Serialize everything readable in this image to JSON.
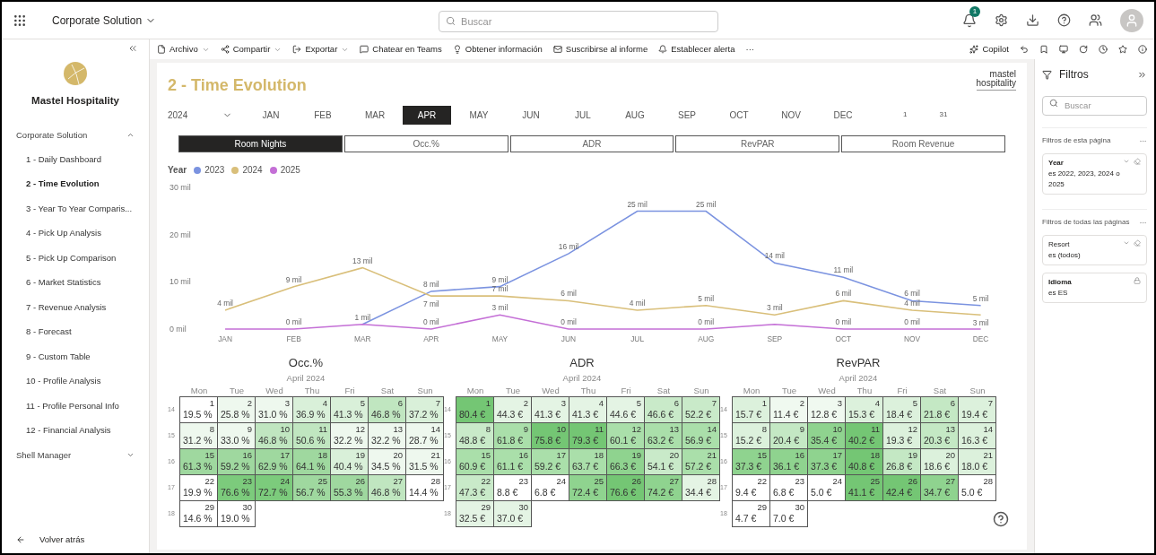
{
  "topbar": {
    "workspace": "Corporate Solution",
    "search": {
      "placeholder": "Buscar"
    },
    "notification_count": "1"
  },
  "toolbar": {
    "items": [
      {
        "label": "Archivo",
        "dropdown": true
      },
      {
        "label": "Compartir",
        "dropdown": true
      },
      {
        "label": "Exportar",
        "dropdown": true
      },
      {
        "label": "Chatear en Teams",
        "dropdown": false
      },
      {
        "label": "Obtener información",
        "dropdown": false
      },
      {
        "label": "Suscribirse al informe",
        "dropdown": false
      },
      {
        "label": "Establecer alerta",
        "dropdown": false
      }
    ],
    "more": "···",
    "copilot": "Copilot"
  },
  "sidebar": {
    "brand": "Mastel Hospitality",
    "sections": [
      {
        "label": "Corporate Solution",
        "expanded": true,
        "children": [
          {
            "label": "1 - Daily Dashboard",
            "selected": false
          },
          {
            "label": "2 - Time Evolution",
            "selected": true
          },
          {
            "label": "3 - Year To Year Comparis...",
            "selected": false
          },
          {
            "label": "4 - Pick Up Analysis",
            "selected": false
          },
          {
            "label": "5 - Pick Up Comparison",
            "selected": false
          },
          {
            "label": "6 - Market Statistics",
            "selected": false
          },
          {
            "label": "7 - Revenue Analysis",
            "selected": false
          },
          {
            "label": "8 - Forecast",
            "selected": false
          },
          {
            "label": "9 - Custom Table",
            "selected": false
          },
          {
            "label": "10 - Profile Analysis",
            "selected": false
          },
          {
            "label": "11 - Profile Personal Info",
            "selected": false
          },
          {
            "label": "12 - Financial Analysis",
            "selected": false
          }
        ]
      },
      {
        "label": "Shell Manager",
        "expanded": false
      }
    ],
    "back": "Volver atrás"
  },
  "report": {
    "title": "2 - Time Evolution",
    "logo_lines": [
      "mastel",
      "hospitality"
    ],
    "year": "2024",
    "months": [
      {
        "label": "JAN",
        "selected": false
      },
      {
        "label": "FEB",
        "selected": false
      },
      {
        "label": "MAR",
        "selected": false
      },
      {
        "label": "APR",
        "selected": true
      },
      {
        "label": "MAY",
        "selected": false
      },
      {
        "label": "JUN",
        "selected": false
      },
      {
        "label": "JUL",
        "selected": false
      },
      {
        "label": "AUG",
        "selected": false
      },
      {
        "label": "SEP",
        "selected": false
      },
      {
        "label": "OCT",
        "selected": false
      },
      {
        "label": "NOV",
        "selected": false
      },
      {
        "label": "DEC",
        "selected": false
      }
    ],
    "day_range": [
      "1",
      "31"
    ],
    "metrics": [
      {
        "label": "Room Nights",
        "selected": true
      },
      {
        "label": "Occ.%",
        "selected": false
      },
      {
        "label": "ADR",
        "selected": false
      },
      {
        "label": "RevPAR",
        "selected": false
      },
      {
        "label": "Room Revenue",
        "selected": false
      }
    ],
    "legend_title": "Year",
    "chart_data": {
      "type": "line",
      "categories": [
        "JAN",
        "FEB",
        "MAR",
        "APR",
        "MAY",
        "JUN",
        "JUL",
        "AUG",
        "SEP",
        "OCT",
        "NOV",
        "DEC"
      ],
      "ylim": [
        0,
        30
      ],
      "yticks": [
        {
          "value": 0,
          "label": "0 mil"
        },
        {
          "value": 10,
          "label": "10 mil"
        },
        {
          "value": 20,
          "label": "20 mil"
        },
        {
          "value": 30,
          "label": "30 mil"
        }
      ],
      "series": [
        {
          "name": "2023",
          "color": "#7b93e0",
          "values": [
            null,
            null,
            1,
            8,
            9,
            16,
            25,
            25,
            14,
            11,
            6,
            5
          ],
          "value_labels": [
            null,
            null,
            "1 mil",
            "8 mil",
            "9 mil",
            "16 mil",
            "25 mil",
            "25 mil",
            "14 mil",
            "11 mil",
            "6 mil",
            "5 mil"
          ]
        },
        {
          "name": "2024",
          "color": "#d9bf7a",
          "values": [
            4,
            9,
            13,
            7,
            7,
            6,
            4,
            5,
            3,
            6,
            4,
            3
          ],
          "value_labels": [
            "4 mil",
            "9 mil",
            "13 mil",
            "7 mil",
            "7 mil",
            "6 mil",
            "4 mil",
            "5 mil",
            "3 mil",
            "6 mil",
            "4 mil",
            "3 mil"
          ]
        },
        {
          "name": "2025",
          "color": "#c46fd6",
          "values": [
            0,
            0,
            1,
            0,
            3,
            0,
            0,
            0,
            1,
            0,
            0,
            0
          ],
          "value_labels": [
            null,
            "0 mil",
            null,
            "0 mil",
            "3 mil",
            "0 mil",
            null,
            "0 mil",
            null,
            "0 mil",
            "0 mil",
            null
          ]
        }
      ]
    },
    "calendars": [
      {
        "title": "Occ.%",
        "month": "April 2024",
        "weekdays": [
          "Mon",
          "Tue",
          "Wed",
          "Thu",
          "Fri",
          "Sat",
          "Sun"
        ],
        "weeks": [
          "14",
          "15",
          "16",
          "17",
          "18"
        ],
        "cells": [
          {
            "day": "1",
            "value": "19.5 %",
            "color": "#ffffff"
          },
          {
            "day": "2",
            "value": "25.8 %",
            "color": "#eef8ee"
          },
          {
            "day": "3",
            "value": "31.0 %",
            "color": "#eef8ee"
          },
          {
            "day": "4",
            "value": "36.9 %",
            "color": "#d9f0d9"
          },
          {
            "day": "5",
            "value": "41.3 %",
            "color": "#d9f0d9"
          },
          {
            "day": "6",
            "value": "46.8 %",
            "color": "#c0e6c0"
          },
          {
            "day": "7",
            "value": "37.2 %",
            "color": "#d9f0d9"
          },
          {
            "day": "8",
            "value": "31.2 %",
            "color": "#eef8ee"
          },
          {
            "day": "9",
            "value": "33.0 %",
            "color": "#eef8ee"
          },
          {
            "day": "10",
            "value": "46.8 %",
            "color": "#c0e6c0"
          },
          {
            "day": "11",
            "value": "50.6 %",
            "color": "#c0e6c0"
          },
          {
            "day": "12",
            "value": "32.2 %",
            "color": "#eef8ee"
          },
          {
            "day": "13",
            "value": "32.2 %",
            "color": "#eef8ee"
          },
          {
            "day": "14",
            "value": "28.7 %",
            "color": "#eef8ee"
          },
          {
            "day": "15",
            "value": "61.3 %",
            "color": "#9fd89f"
          },
          {
            "day": "16",
            "value": "59.2 %",
            "color": "#9fd89f"
          },
          {
            "day": "17",
            "value": "62.9 %",
            "color": "#9fd89f"
          },
          {
            "day": "18",
            "value": "64.1 %",
            "color": "#9fd89f"
          },
          {
            "day": "19",
            "value": "40.4 %",
            "color": "#d9f0d9"
          },
          {
            "day": "20",
            "value": "34.5 %",
            "color": "#eef8ee"
          },
          {
            "day": "21",
            "value": "31.5 %",
            "color": "#eef8ee"
          },
          {
            "day": "22",
            "value": "19.9 %",
            "color": "#ffffff"
          },
          {
            "day": "23",
            "value": "76.6 %",
            "color": "#7ccb7c"
          },
          {
            "day": "24",
            "value": "72.7 %",
            "color": "#7ccb7c"
          },
          {
            "day": "25",
            "value": "56.7 %",
            "color": "#9fd89f"
          },
          {
            "day": "26",
            "value": "55.3 %",
            "color": "#9fd89f"
          },
          {
            "day": "27",
            "value": "46.8 %",
            "color": "#c0e6c0"
          },
          {
            "day": "28",
            "value": "14.4 %",
            "color": "#ffffff"
          },
          {
            "day": "29",
            "value": "14.6 %",
            "color": "#ffffff"
          },
          {
            "day": "30",
            "value": "19.0 %",
            "color": "#ffffff"
          }
        ]
      },
      {
        "title": "ADR",
        "month": "April 2024",
        "weekdays": [
          "Mon",
          "Tue",
          "Wed",
          "Thu",
          "Fri",
          "Sat",
          "Sun"
        ],
        "weeks": [
          "14",
          "15",
          "16",
          "17",
          "18"
        ],
        "cells": [
          {
            "day": "1",
            "value": "80.4 €",
            "color": "#74c674"
          },
          {
            "day": "2",
            "value": "44.3 €",
            "color": "#e4f4e4"
          },
          {
            "day": "3",
            "value": "41.3 €",
            "color": "#e4f4e4"
          },
          {
            "day": "4",
            "value": "41.3 €",
            "color": "#e4f4e4"
          },
          {
            "day": "5",
            "value": "44.6 €",
            "color": "#e4f4e4"
          },
          {
            "day": "6",
            "value": "46.6 €",
            "color": "#c9eac9"
          },
          {
            "day": "7",
            "value": "52.2 €",
            "color": "#c9eac9"
          },
          {
            "day": "8",
            "value": "48.8 €",
            "color": "#c9eac9"
          },
          {
            "day": "9",
            "value": "61.8 €",
            "color": "#aadfaa"
          },
          {
            "day": "10",
            "value": "75.8 €",
            "color": "#74c674"
          },
          {
            "day": "11",
            "value": "79.3 €",
            "color": "#74c674"
          },
          {
            "day": "12",
            "value": "60.1 €",
            "color": "#aadfaa"
          },
          {
            "day": "13",
            "value": "63.2 €",
            "color": "#aadfaa"
          },
          {
            "day": "14",
            "value": "56.9 €",
            "color": "#aadfaa"
          },
          {
            "day": "15",
            "value": "60.9 €",
            "color": "#aadfaa"
          },
          {
            "day": "16",
            "value": "61.1 €",
            "color": "#aadfaa"
          },
          {
            "day": "17",
            "value": "59.2 €",
            "color": "#aadfaa"
          },
          {
            "day": "18",
            "value": "63.7 €",
            "color": "#aadfaa"
          },
          {
            "day": "19",
            "value": "66.3 €",
            "color": "#8fd38f"
          },
          {
            "day": "20",
            "value": "54.1 €",
            "color": "#c9eac9"
          },
          {
            "day": "21",
            "value": "57.2 €",
            "color": "#aadfaa"
          },
          {
            "day": "22",
            "value": "47.3 €",
            "color": "#c9eac9"
          },
          {
            "day": "23",
            "value": "8.8 €",
            "color": "#ffffff"
          },
          {
            "day": "24",
            "value": "6.8 €",
            "color": "#ffffff"
          },
          {
            "day": "25",
            "value": "72.4 €",
            "color": "#8fd38f"
          },
          {
            "day": "26",
            "value": "76.6 €",
            "color": "#74c674"
          },
          {
            "day": "27",
            "value": "74.2 €",
            "color": "#8fd38f"
          },
          {
            "day": "28",
            "value": "34.4 €",
            "color": "#e4f4e4"
          },
          {
            "day": "29",
            "value": "32.5 €",
            "color": "#e4f4e4"
          },
          {
            "day": "30",
            "value": "37.0 €",
            "color": "#e4f4e4"
          }
        ]
      },
      {
        "title": "RevPAR",
        "month": "April 2024",
        "weekdays": [
          "Mon",
          "Tue",
          "Wed",
          "Thu",
          "Fri",
          "Sat",
          "Sun"
        ],
        "weeks": [
          "14",
          "15",
          "16",
          "17",
          "18"
        ],
        "cells": [
          {
            "day": "1",
            "value": "15.7 €",
            "color": "#dcf1dc"
          },
          {
            "day": "2",
            "value": "11.4 €",
            "color": "#f0f9f0"
          },
          {
            "day": "3",
            "value": "12.8 €",
            "color": "#f0f9f0"
          },
          {
            "day": "4",
            "value": "15.3 €",
            "color": "#dcf1dc"
          },
          {
            "day": "5",
            "value": "18.4 €",
            "color": "#dcf1dc"
          },
          {
            "day": "6",
            "value": "21.8 €",
            "color": "#c4e8c4"
          },
          {
            "day": "7",
            "value": "19.4 €",
            "color": "#dcf1dc"
          },
          {
            "day": "8",
            "value": "15.2 €",
            "color": "#dcf1dc"
          },
          {
            "day": "9",
            "value": "20.4 €",
            "color": "#c4e8c4"
          },
          {
            "day": "10",
            "value": "35.4 €",
            "color": "#8fd38f"
          },
          {
            "day": "11",
            "value": "40.2 €",
            "color": "#74c674"
          },
          {
            "day": "12",
            "value": "19.3 €",
            "color": "#dcf1dc"
          },
          {
            "day": "13",
            "value": "20.3 €",
            "color": "#c4e8c4"
          },
          {
            "day": "14",
            "value": "16.3 €",
            "color": "#dcf1dc"
          },
          {
            "day": "15",
            "value": "37.3 €",
            "color": "#8fd38f"
          },
          {
            "day": "16",
            "value": "36.1 €",
            "color": "#8fd38f"
          },
          {
            "day": "17",
            "value": "37.3 €",
            "color": "#8fd38f"
          },
          {
            "day": "18",
            "value": "40.8 €",
            "color": "#74c674"
          },
          {
            "day": "19",
            "value": "26.8 €",
            "color": "#c4e8c4"
          },
          {
            "day": "20",
            "value": "18.6 €",
            "color": "#dcf1dc"
          },
          {
            "day": "21",
            "value": "18.0 €",
            "color": "#dcf1dc"
          },
          {
            "day": "22",
            "value": "9.4 €",
            "color": "#ffffff"
          },
          {
            "day": "23",
            "value": "6.8 €",
            "color": "#ffffff"
          },
          {
            "day": "24",
            "value": "5.0 €",
            "color": "#ffffff"
          },
          {
            "day": "25",
            "value": "41.1 €",
            "color": "#74c674"
          },
          {
            "day": "26",
            "value": "42.4 €",
            "color": "#74c674"
          },
          {
            "day": "27",
            "value": "34.7 €",
            "color": "#8fd38f"
          },
          {
            "day": "28",
            "value": "5.0 €",
            "color": "#ffffff"
          },
          {
            "day": "29",
            "value": "4.7 €",
            "color": "#ffffff"
          },
          {
            "day": "30",
            "value": "7.0 €",
            "color": "#ffffff"
          }
        ]
      }
    ]
  },
  "filters": {
    "title": "Filtros",
    "search": {
      "placeholder": "Buscar"
    },
    "groups": [
      {
        "title": "Filtros de esta página",
        "cards": [
          {
            "name": "Year",
            "value": "es 2022, 2023, 2024 o 2025",
            "bold": true,
            "locked": false
          }
        ]
      },
      {
        "title": "Filtros de todas las páginas",
        "cards": [
          {
            "name": "Resort",
            "value": "es (todos)",
            "bold": false,
            "locked": false
          },
          {
            "name": "Idioma",
            "value": "es ES",
            "bold": true,
            "locked": true
          }
        ]
      }
    ]
  }
}
